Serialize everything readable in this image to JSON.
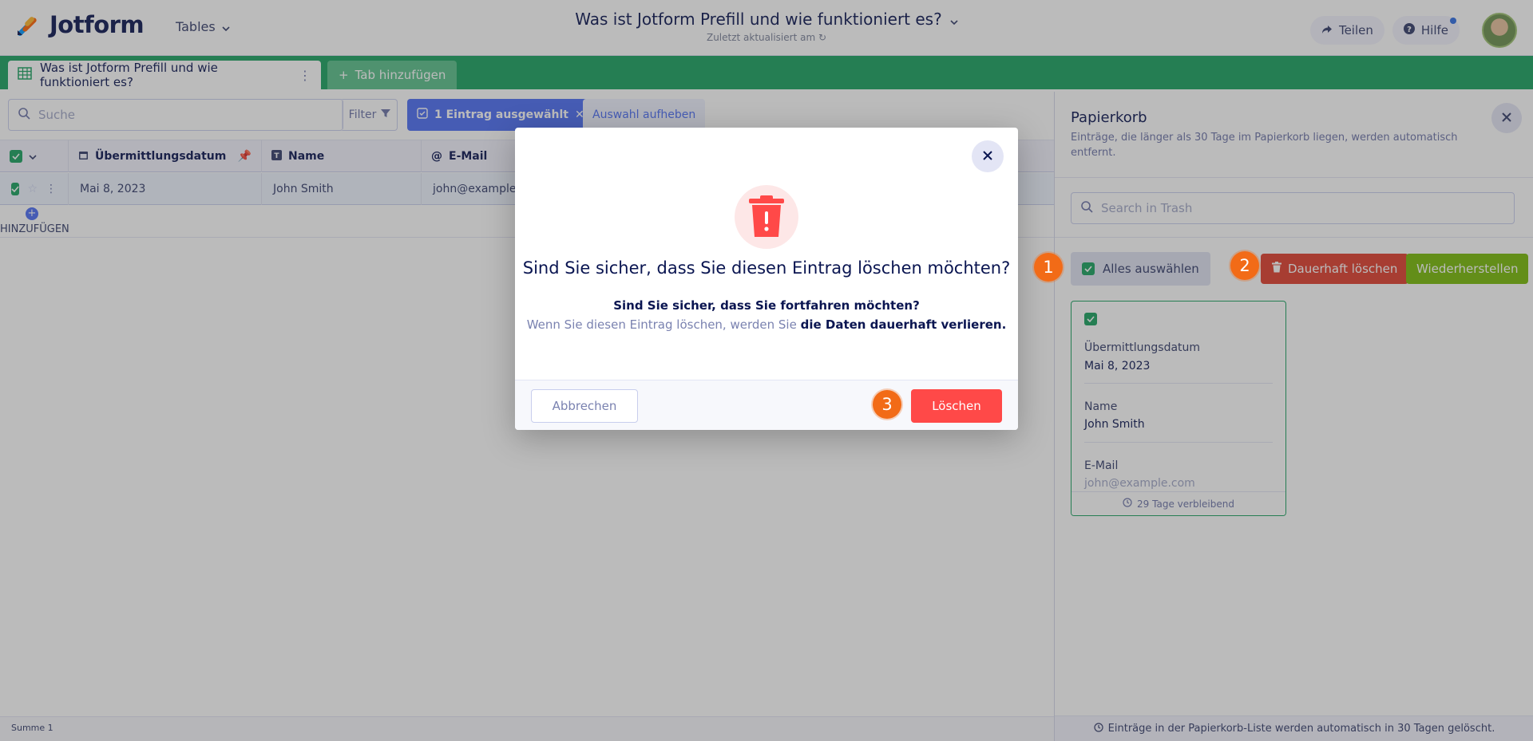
{
  "header": {
    "brand": "Jotform",
    "tables_menu": "Tables",
    "title": "Was ist Jotform Prefill und wie funktioniert es?",
    "subtitle": "Zuletzt aktualisiert am",
    "share_label": "Teilen",
    "help_label": "Hilfe"
  },
  "tabs": {
    "active_label": "Was ist Jotform Prefill und wie funktioniert es?",
    "add_label": "Tab hinzufügen"
  },
  "toolbar": {
    "search_placeholder": "Suche",
    "filter_label": "Filter",
    "selected_label": "1 Eintrag ausgewählt",
    "clear_label": "Auswahl aufheben"
  },
  "grid": {
    "columns": [
      "Übermittlungsdatum",
      "Name",
      "E-Mail"
    ],
    "row": [
      "Mai 8, 2023",
      "John Smith",
      "john@example.c"
    ],
    "add_label": "HINZUFÜGEN",
    "footer": "Summe 1"
  },
  "trash": {
    "title": "Papierkorb",
    "description": "Einträge, die länger als 30 Tage im Papierkorb liegen, werden automatisch entfernt.",
    "search_placeholder": "Search in Trash",
    "select_all": "Alles auswählen",
    "delete_permanent": "Dauerhaft löschen",
    "restore": "Wiederherstellen",
    "card": {
      "field1_label": "Übermittlungsdatum",
      "field1_value": "Mai 8, 2023",
      "field2_label": "Name",
      "field2_value": "John Smith",
      "field3_label": "E-Mail",
      "field3_value": "john@example.com",
      "remaining": "29 Tage verbleibend"
    },
    "footer_note": "Einträge in der Papierkorb-Liste werden automatisch in 30 Tagen gelöscht."
  },
  "modal": {
    "title": "Sind Sie sicher, dass Sie diesen Eintrag löschen möchten?",
    "question": "Sind Sie sicher, dass Sie fortfahren möchten?",
    "warning_prefix": "Wenn Sie diesen Eintrag löschen, werden Sie ",
    "warning_bold": "die Daten dauerhaft verlieren.",
    "cancel_label": "Abbrechen",
    "delete_label": "Löschen"
  },
  "steps": [
    "1",
    "2",
    "3"
  ],
  "colors": {
    "accent_green": "#1aa260",
    "danger_red": "#ff4948",
    "step_orange": "#f26b17",
    "restore_green": "#78bb07"
  }
}
